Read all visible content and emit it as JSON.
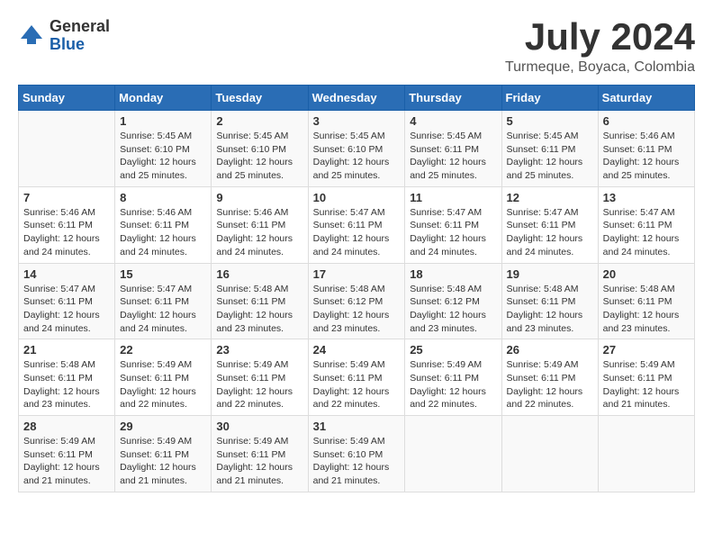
{
  "header": {
    "logo_general": "General",
    "logo_blue": "Blue",
    "month_title": "July 2024",
    "location": "Turmeque, Boyaca, Colombia"
  },
  "calendar": {
    "days_of_week": [
      "Sunday",
      "Monday",
      "Tuesday",
      "Wednesday",
      "Thursday",
      "Friday",
      "Saturday"
    ],
    "weeks": [
      [
        {
          "day": "",
          "info": ""
        },
        {
          "day": "1",
          "info": "Sunrise: 5:45 AM\nSunset: 6:10 PM\nDaylight: 12 hours\nand 25 minutes."
        },
        {
          "day": "2",
          "info": "Sunrise: 5:45 AM\nSunset: 6:10 PM\nDaylight: 12 hours\nand 25 minutes."
        },
        {
          "day": "3",
          "info": "Sunrise: 5:45 AM\nSunset: 6:10 PM\nDaylight: 12 hours\nand 25 minutes."
        },
        {
          "day": "4",
          "info": "Sunrise: 5:45 AM\nSunset: 6:11 PM\nDaylight: 12 hours\nand 25 minutes."
        },
        {
          "day": "5",
          "info": "Sunrise: 5:45 AM\nSunset: 6:11 PM\nDaylight: 12 hours\nand 25 minutes."
        },
        {
          "day": "6",
          "info": "Sunrise: 5:46 AM\nSunset: 6:11 PM\nDaylight: 12 hours\nand 25 minutes."
        }
      ],
      [
        {
          "day": "7",
          "info": "Sunrise: 5:46 AM\nSunset: 6:11 PM\nDaylight: 12 hours\nand 24 minutes."
        },
        {
          "day": "8",
          "info": "Sunrise: 5:46 AM\nSunset: 6:11 PM\nDaylight: 12 hours\nand 24 minutes."
        },
        {
          "day": "9",
          "info": "Sunrise: 5:46 AM\nSunset: 6:11 PM\nDaylight: 12 hours\nand 24 minutes."
        },
        {
          "day": "10",
          "info": "Sunrise: 5:47 AM\nSunset: 6:11 PM\nDaylight: 12 hours\nand 24 minutes."
        },
        {
          "day": "11",
          "info": "Sunrise: 5:47 AM\nSunset: 6:11 PM\nDaylight: 12 hours\nand 24 minutes."
        },
        {
          "day": "12",
          "info": "Sunrise: 5:47 AM\nSunset: 6:11 PM\nDaylight: 12 hours\nand 24 minutes."
        },
        {
          "day": "13",
          "info": "Sunrise: 5:47 AM\nSunset: 6:11 PM\nDaylight: 12 hours\nand 24 minutes."
        }
      ],
      [
        {
          "day": "14",
          "info": "Sunrise: 5:47 AM\nSunset: 6:11 PM\nDaylight: 12 hours\nand 24 minutes."
        },
        {
          "day": "15",
          "info": "Sunrise: 5:47 AM\nSunset: 6:11 PM\nDaylight: 12 hours\nand 24 minutes."
        },
        {
          "day": "16",
          "info": "Sunrise: 5:48 AM\nSunset: 6:11 PM\nDaylight: 12 hours\nand 23 minutes."
        },
        {
          "day": "17",
          "info": "Sunrise: 5:48 AM\nSunset: 6:12 PM\nDaylight: 12 hours\nand 23 minutes."
        },
        {
          "day": "18",
          "info": "Sunrise: 5:48 AM\nSunset: 6:12 PM\nDaylight: 12 hours\nand 23 minutes."
        },
        {
          "day": "19",
          "info": "Sunrise: 5:48 AM\nSunset: 6:11 PM\nDaylight: 12 hours\nand 23 minutes."
        },
        {
          "day": "20",
          "info": "Sunrise: 5:48 AM\nSunset: 6:11 PM\nDaylight: 12 hours\nand 23 minutes."
        }
      ],
      [
        {
          "day": "21",
          "info": "Sunrise: 5:48 AM\nSunset: 6:11 PM\nDaylight: 12 hours\nand 23 minutes."
        },
        {
          "day": "22",
          "info": "Sunrise: 5:49 AM\nSunset: 6:11 PM\nDaylight: 12 hours\nand 22 minutes."
        },
        {
          "day": "23",
          "info": "Sunrise: 5:49 AM\nSunset: 6:11 PM\nDaylight: 12 hours\nand 22 minutes."
        },
        {
          "day": "24",
          "info": "Sunrise: 5:49 AM\nSunset: 6:11 PM\nDaylight: 12 hours\nand 22 minutes."
        },
        {
          "day": "25",
          "info": "Sunrise: 5:49 AM\nSunset: 6:11 PM\nDaylight: 12 hours\nand 22 minutes."
        },
        {
          "day": "26",
          "info": "Sunrise: 5:49 AM\nSunset: 6:11 PM\nDaylight: 12 hours\nand 22 minutes."
        },
        {
          "day": "27",
          "info": "Sunrise: 5:49 AM\nSunset: 6:11 PM\nDaylight: 12 hours\nand 21 minutes."
        }
      ],
      [
        {
          "day": "28",
          "info": "Sunrise: 5:49 AM\nSunset: 6:11 PM\nDaylight: 12 hours\nand 21 minutes."
        },
        {
          "day": "29",
          "info": "Sunrise: 5:49 AM\nSunset: 6:11 PM\nDaylight: 12 hours\nand 21 minutes."
        },
        {
          "day": "30",
          "info": "Sunrise: 5:49 AM\nSunset: 6:11 PM\nDaylight: 12 hours\nand 21 minutes."
        },
        {
          "day": "31",
          "info": "Sunrise: 5:49 AM\nSunset: 6:10 PM\nDaylight: 12 hours\nand 21 minutes."
        },
        {
          "day": "",
          "info": ""
        },
        {
          "day": "",
          "info": ""
        },
        {
          "day": "",
          "info": ""
        }
      ]
    ]
  }
}
